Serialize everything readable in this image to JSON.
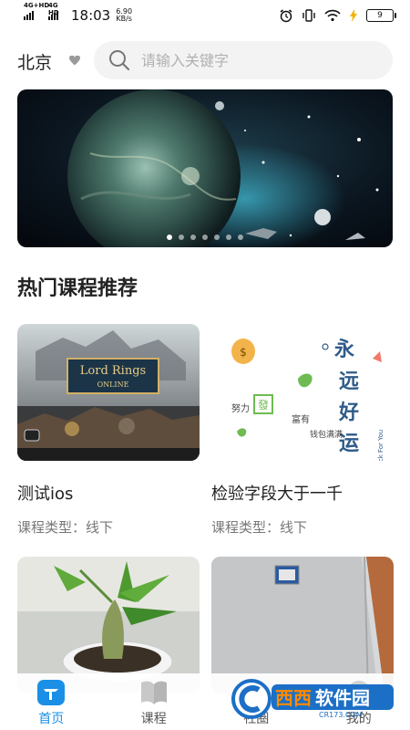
{
  "status_bar": {
    "network1": "4G+HD",
    "network2": "4G HD",
    "time": "18:03",
    "speed_value": "6.90",
    "speed_unit": "KB/s",
    "battery": "9"
  },
  "header": {
    "city": "北京",
    "search_placeholder": "请输入关键字"
  },
  "banner": {
    "slide_count": 7,
    "active_slide": 0
  },
  "section_title": "热门课程推荐",
  "courses": [
    {
      "title": "测试ios",
      "type_label": "课程类型：线下"
    },
    {
      "title": "检验字段大于一千",
      "type_label": "课程类型：线下"
    },
    {
      "title": "",
      "type_label": ""
    },
    {
      "title": "",
      "type_label": ""
    }
  ],
  "card2_image_text": {
    "big": [
      "永",
      "远",
      "好",
      "运"
    ],
    "small1": "努力",
    "small2": "富有",
    "small3": "钱包满满",
    "stamp": "發",
    "english": "Good Luck For You"
  },
  "bottom_nav": {
    "items": [
      {
        "label": "首页"
      },
      {
        "label": "课程"
      },
      {
        "label": "社圈"
      },
      {
        "label": "我的"
      }
    ]
  },
  "watermark": {
    "text": "西西软件园",
    "url": "CR173.COM"
  },
  "colors": {
    "accent": "#1b8fe6",
    "text_primary": "#222222",
    "text_secondary": "#777777",
    "search_bg": "#f3f3f3"
  }
}
